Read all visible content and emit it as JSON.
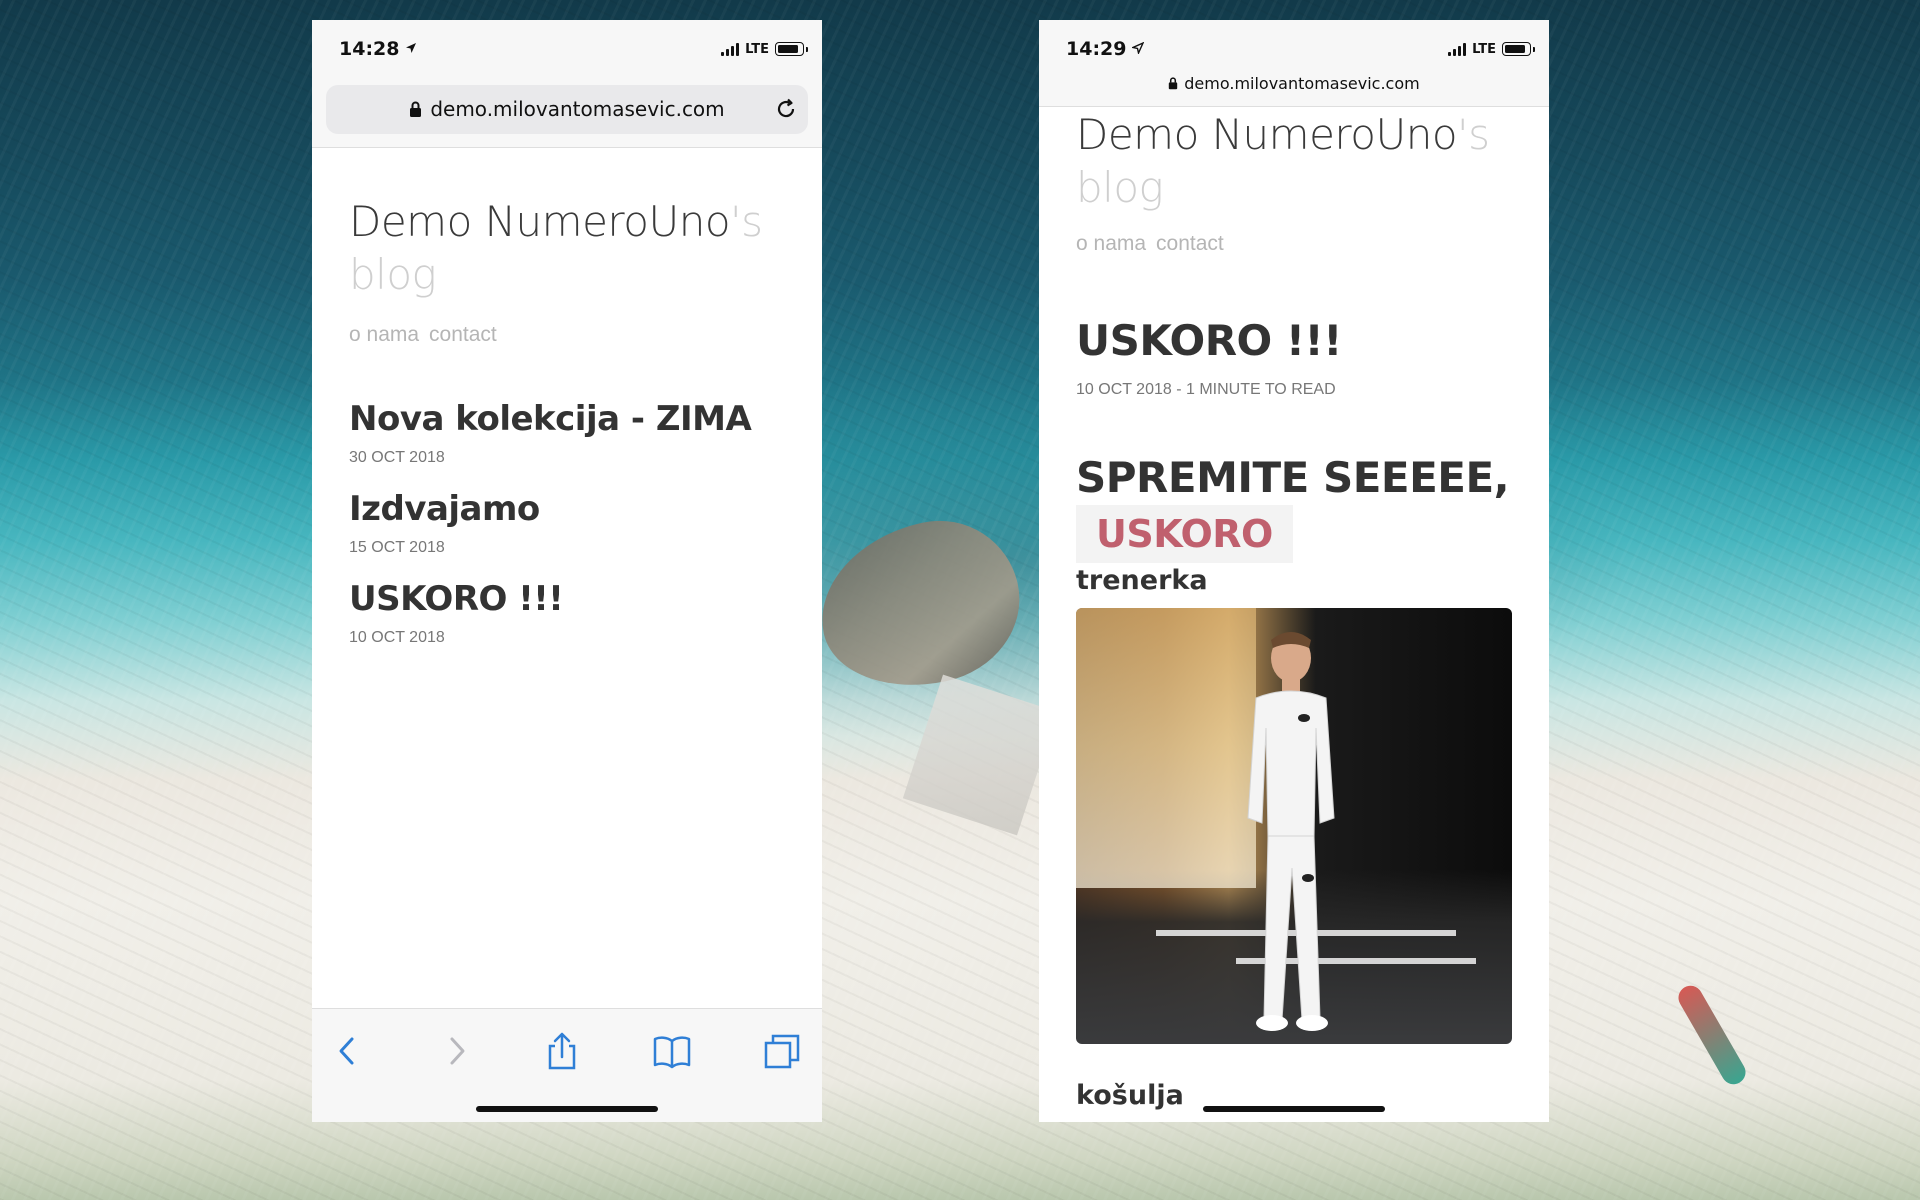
{
  "left_phone": {
    "status": {
      "time": "14:28",
      "network": "LTE"
    },
    "url": "demo.milovantomasevic.com",
    "blog": {
      "title_main": "Demo NumeroUno",
      "title_suffix": "'s",
      "title_second_line": "blog"
    },
    "nav": [
      "o nama",
      "contact"
    ],
    "posts": [
      {
        "title": "Nova kolekcija - ZIMA",
        "date": "30 OCT 2018"
      },
      {
        "title": "Izdvajamo",
        "date": "15 OCT 2018"
      },
      {
        "title": "USKORO !!!",
        "date": "10 OCT 2018"
      }
    ],
    "toolbar": {
      "icons": [
        "back-icon",
        "forward-icon",
        "share-icon",
        "bookmarks-icon",
        "tabs-icon"
      ],
      "accent_color": "#2f7fd6",
      "disabled_color": "#b8b8bd"
    }
  },
  "right_phone": {
    "status": {
      "time": "14:29",
      "network": "LTE"
    },
    "url": "demo.milovantomasevic.com",
    "blog": {
      "title_main": "Demo NumeroUno",
      "title_suffix": "'s",
      "title_second_line": "blog"
    },
    "nav": [
      "o nama",
      "contact"
    ],
    "article": {
      "title": "USKORO !!!",
      "meta": "10 OCT 2018 - 1 MINUTE TO READ",
      "heading": "SPREMITE SEEEEE,",
      "heading_code": "USKORO",
      "code_color": "#c0606e",
      "section_1": "trenerka",
      "section_2": "košulja"
    }
  }
}
